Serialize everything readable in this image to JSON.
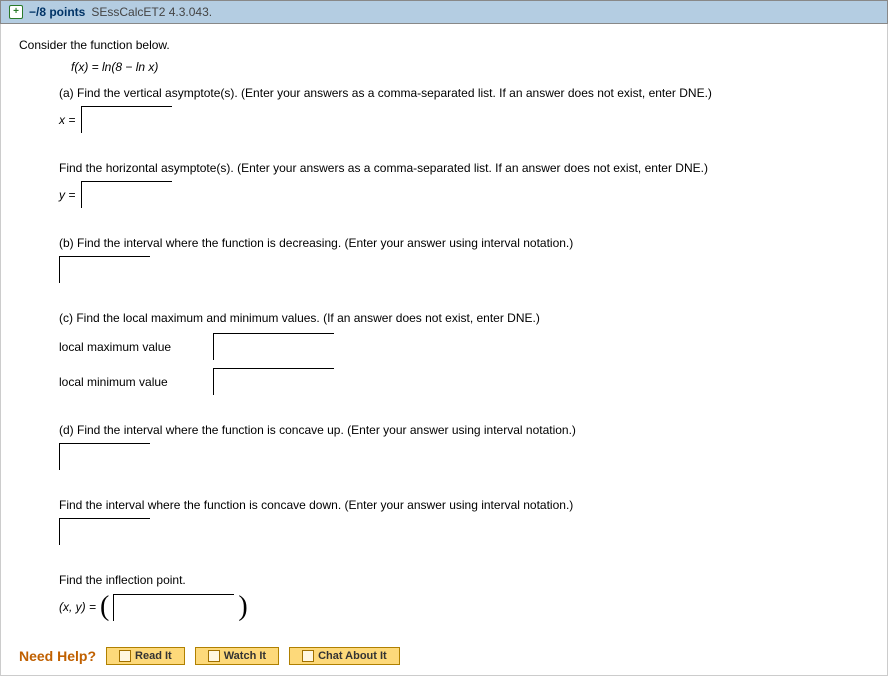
{
  "header": {
    "points": "−/8 points",
    "source": "SEssCalcET2 4.3.043."
  },
  "intro": "Consider the function below.",
  "function": "f(x) = ln(8 − ln x)",
  "parts": {
    "a": {
      "prompt": "(a) Find the vertical asymptote(s). (Enter your answers as a comma-separated list. If an answer does not exist, enter DNE.)",
      "var": "x ="
    },
    "ha": {
      "prompt": "Find the horizontal asymptote(s). (Enter your answers as a comma-separated list. If an answer does not exist, enter DNE.)",
      "var": "y ="
    },
    "b": {
      "prompt": "(b) Find the interval where the function is decreasing. (Enter your answer using interval notation.)"
    },
    "c": {
      "prompt": "(c) Find the local maximum and minimum values. (If an answer does not exist, enter DNE.)",
      "max_label": "local maximum value",
      "min_label": "local minimum value"
    },
    "d": {
      "prompt": "(d) Find the interval where the function is concave up. (Enter your answer using interval notation.)"
    },
    "cd": {
      "prompt": "Find the interval where the function is concave down. (Enter your answer using interval notation.)"
    },
    "inflection": {
      "prompt": "Find the inflection point.",
      "var": "(x, y) ="
    }
  },
  "help": {
    "label": "Need Help?",
    "read": "Read It",
    "watch": "Watch It",
    "chat": "Chat About It"
  }
}
